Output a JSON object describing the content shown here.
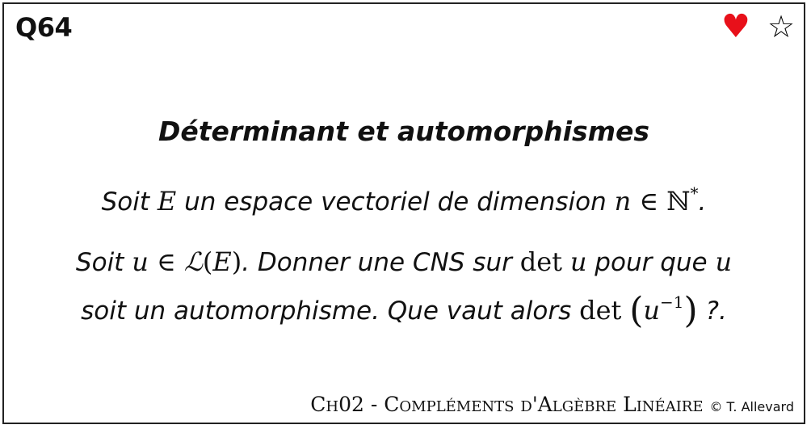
{
  "card": {
    "id": "Q64",
    "heart_color": "#e8101a",
    "title": "Déterminant et automorphismes",
    "line1": {
      "text_a": "Soit ",
      "var_E": "E",
      "text_b": " un espace vectoriel de dimension ",
      "var_n": "n",
      "elem": " ∈ ",
      "set": "ℕ",
      "star": "*",
      "end": "."
    },
    "line2": {
      "text_a": "Soit ",
      "var_u": "u",
      "elem": " ∈ ",
      "script_L": "ℒ",
      "paren_open": "(",
      "var_E": "E",
      "paren_close": ")",
      "text_b": ". Donner une CNS sur ",
      "det": "det",
      "var_u2": "u",
      "text_c": " pour que ",
      "var_u3": "u"
    },
    "line3": {
      "text_a": "soit un automorphisme. Que vaut alors ",
      "det": "det",
      "big_open": "(",
      "var_u": "u",
      "exponent": "−1",
      "big_close": ")",
      "end": " ?."
    },
    "footer": {
      "chapter": "Ch02 - Compléments d'Algèbre Linéaire",
      "copyright": "© T. Allevard"
    }
  }
}
